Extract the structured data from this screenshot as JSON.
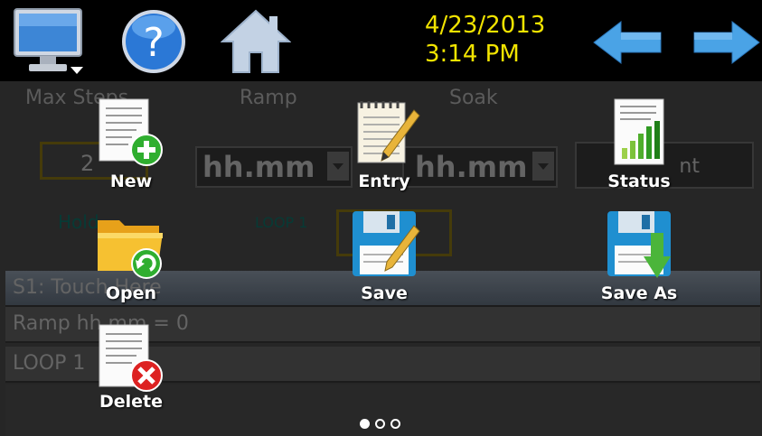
{
  "clock": {
    "date": "4/23/2013",
    "time": "3:14 PM"
  },
  "background": {
    "col_max_steps": "Max Steps",
    "col_ramp": "Ramp",
    "col_soak": "Soak",
    "steps_value": "2",
    "ramp_unit": "hh.mm",
    "soak_unit": "hh.mm",
    "event_value": "nt",
    "hold_label": "Hold",
    "loop_label": "LOOP 1",
    "row1": "S1: Touch Here",
    "row2": "Ramp hh.mm = 0",
    "row3": "LOOP 1"
  },
  "apps": {
    "new": "New",
    "entry": "Entry",
    "status": "Status",
    "open": "Open",
    "save": "Save",
    "save_as": "Save As",
    "delete": "Delete"
  },
  "pager": {
    "current": 1,
    "total": 3
  },
  "colors": {
    "clock": "#f2e400",
    "arrow": "#4aa3e6",
    "accent_green": "#22aa22",
    "delete_red": "#dd2222"
  }
}
